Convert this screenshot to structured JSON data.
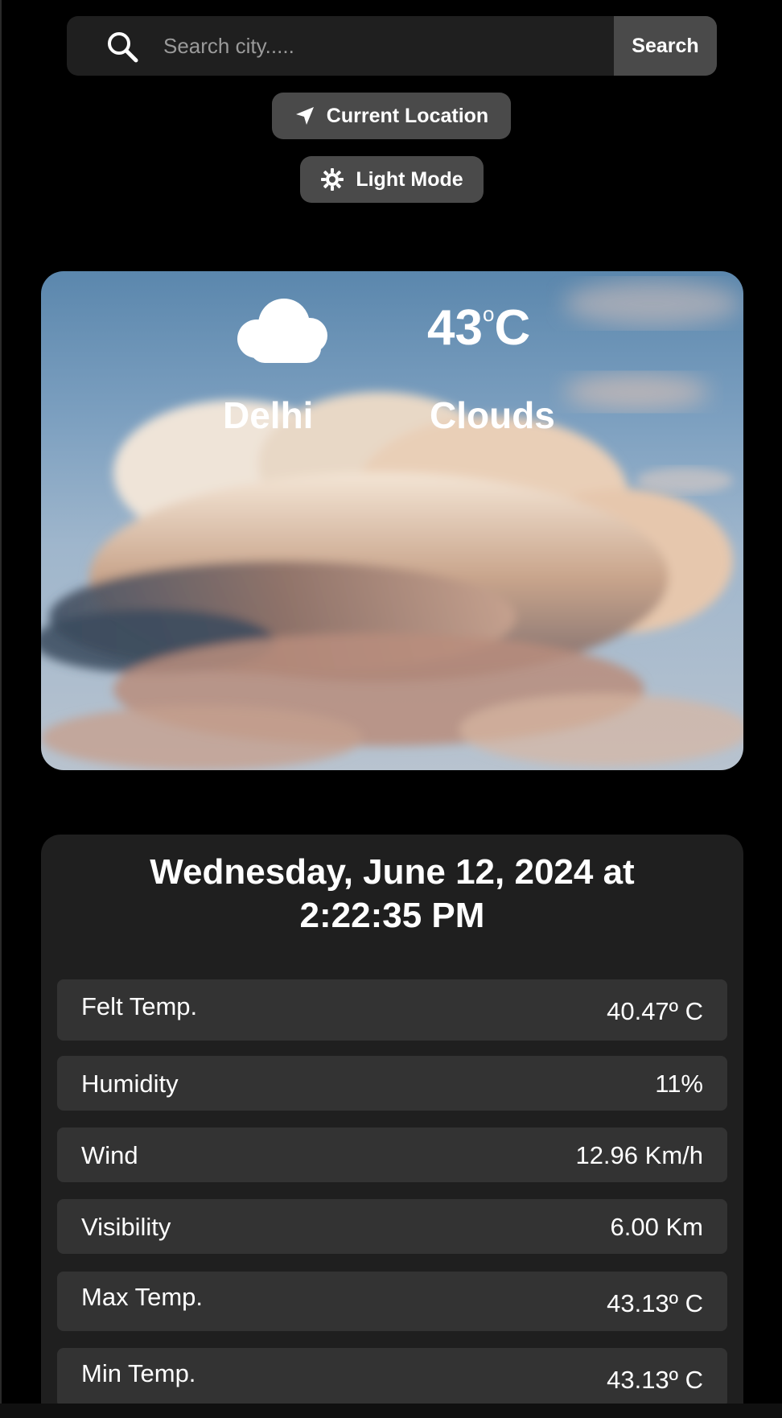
{
  "search": {
    "placeholder": "Search city.....",
    "value": "",
    "button_label": "Search"
  },
  "actions": {
    "current_location_label": "Current Location",
    "mode_label": "Light Mode"
  },
  "current": {
    "temp_value": "43",
    "temp_degree": "o",
    "temp_unit": "C",
    "city": "Delhi",
    "condition": "Clouds",
    "icon": "cloud-icon"
  },
  "details": {
    "datetime": "Wednesday, June 12, 2024 at 2:22:35 PM",
    "rows": [
      {
        "label": "Felt Temp.",
        "value": "40.47º C"
      },
      {
        "label": "Humidity",
        "value": "11%"
      },
      {
        "label": "Wind",
        "value": "12.96 Km/h"
      },
      {
        "label": "Visibility",
        "value": "6.00 Km"
      },
      {
        "label": "Max Temp.",
        "value": "43.13º C"
      },
      {
        "label": "Min Temp.",
        "value": "43.13º C"
      }
    ]
  },
  "colors": {
    "background": "#000000",
    "panel": "#1f1f1f",
    "button": "#4a4a4a",
    "row": "#333333",
    "text": "#ffffff"
  }
}
